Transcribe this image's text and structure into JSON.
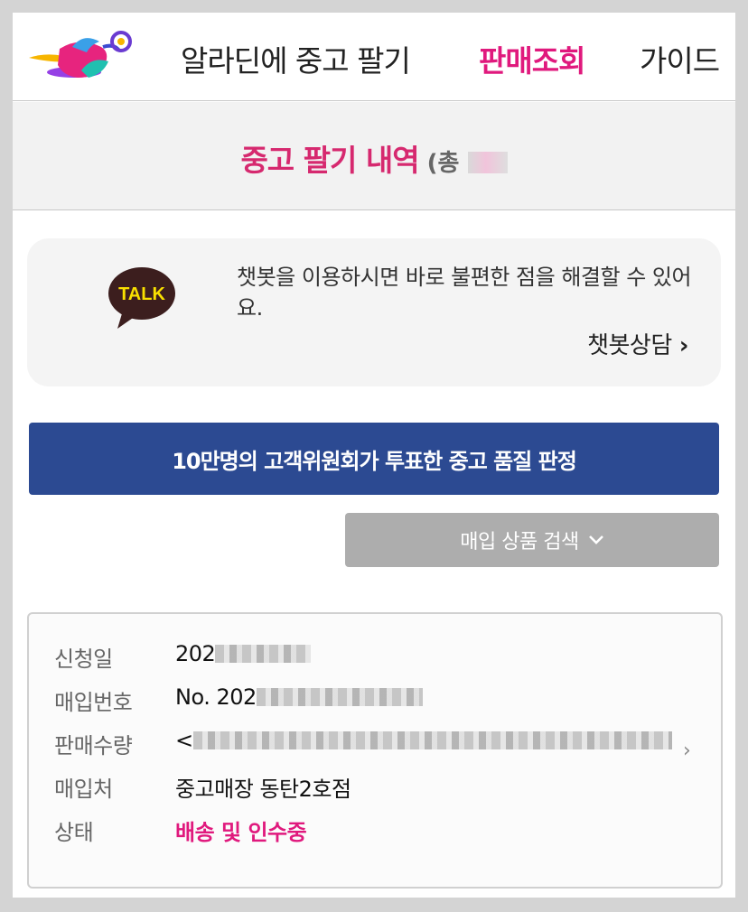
{
  "header": {
    "logo_icon": "aladin-genie-lamp-logo",
    "nav": {
      "sell": "알라딘에 중고 팔기",
      "view": "판매조회",
      "guide": "가이드"
    },
    "active_color": "#e0197d"
  },
  "title": {
    "main": "중고 팔기 내역",
    "count_prefix": "(총"
  },
  "chatbot": {
    "icon": "kakaotalk-talk-icon",
    "icon_text": "TALK",
    "message": "챗봇을 이용하시면 바로 불편한 점을 해결할 수 있어요.",
    "link_label": "챗봇상담",
    "link_chevron": "›"
  },
  "banner": {
    "label": "10만명의 고객위원회가 투표한 중고 품질 판정",
    "color": "#2c4a92"
  },
  "search": {
    "label": "매입 상품 검색",
    "icon": "chevron-down-icon"
  },
  "detail": {
    "rows": [
      {
        "label": "신청일",
        "value": "202"
      },
      {
        "label": "매입번호",
        "value": "No. 202"
      },
      {
        "label": "판매수량",
        "value": "<"
      },
      {
        "label": "매입처",
        "value": "중고매장 동탄2호점"
      },
      {
        "label": "상태",
        "value": "배송 및 인수중"
      }
    ],
    "status_color": "#e0197d"
  }
}
